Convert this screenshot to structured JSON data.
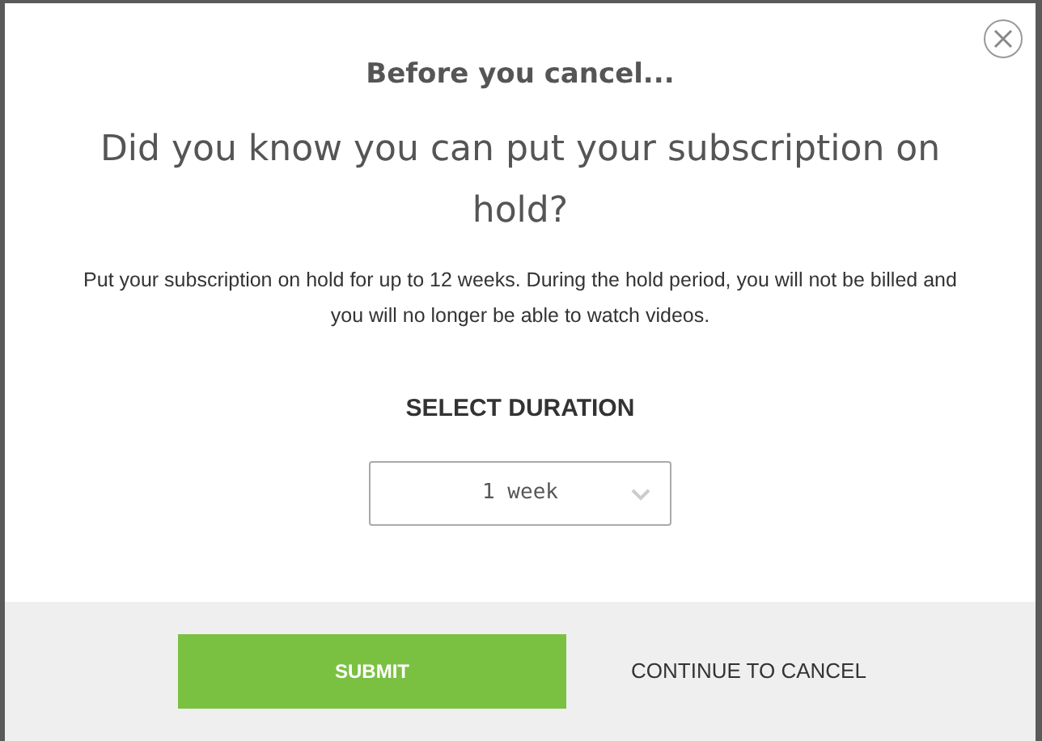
{
  "dialog": {
    "heading": "Before you cancel...",
    "question": "Did you know you can put your subscription on hold?",
    "description": "Put your subscription on hold for up to 12 weeks. During the hold period, you will not be billed and you will no longer be able to watch videos.",
    "duration_label": "SELECT DURATION",
    "duration_select": {
      "value": "1 week"
    }
  },
  "footer": {
    "submit": "SUBMIT",
    "continue": "CONTINUE TO CANCEL"
  }
}
